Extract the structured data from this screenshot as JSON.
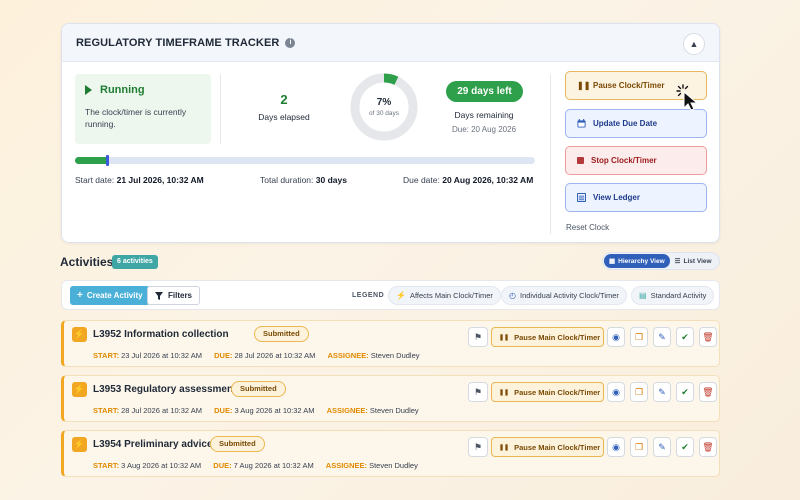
{
  "tracker": {
    "title": "REGULATORY TIMEFRAME TRACKER",
    "status": {
      "title": "Running",
      "description": "The clock/timer is currently running."
    },
    "elapsed": {
      "value": "2",
      "label": "Days elapsed"
    },
    "progress_ring": {
      "percent_label": "7%",
      "sub_label": "of 30 days",
      "fraction": 0.07
    },
    "remaining": {
      "badge": "29 days left",
      "label": "Days remaining",
      "due": "Due: 20 Aug 2026"
    },
    "timeline": {
      "fraction": 0.07,
      "start_label": "Start date:",
      "start_value": "21 Jul 2026, 10:32 AM",
      "duration_label": "Total duration:",
      "duration_value": "30 days",
      "due_label": "Due date:",
      "due_value": "20 Aug 2026, 10:32 AM"
    },
    "actions": {
      "pause": "Pause Clock/Timer",
      "update": "Update Due Date",
      "stop": "Stop Clock/Timer",
      "ledger": "View Ledger",
      "reset": "Reset Clock"
    }
  },
  "activities": {
    "title": "Activities",
    "count": "6 activities",
    "views": {
      "hierarchy": "Hierarchy View",
      "list": "List View"
    },
    "toolbar": {
      "create": "Create Activity",
      "filters": "Filters"
    },
    "legend": {
      "label": "LEGEND",
      "items": [
        "Affects Main Clock/Timer",
        "Individual Activity Clock/Timer",
        "Standard Activity"
      ]
    },
    "meta_labels": {
      "start": "START:",
      "due": "DUE:",
      "assignee": "ASSIGNEE:"
    },
    "pause_main_label": "Pause Main Clock/Timer",
    "items": [
      {
        "id": "L3952",
        "name": "L3952 Information collection",
        "status": "Submitted",
        "start": "23 Jul 2026 at 10:32 AM",
        "due": "28 Jul 2026 at 10:32 AM",
        "assignee": "Steven Dudley"
      },
      {
        "id": "L3953",
        "name": "L3953 Regulatory assessment",
        "status": "Submitted",
        "start": "28 Jul 2026 at 10:32 AM",
        "due": "3 Aug 2026 at 10:32 AM",
        "assignee": "Steven Dudley"
      },
      {
        "id": "L3954",
        "name": "L3954 Preliminary advice",
        "status": "Submitted",
        "start": "3 Aug 2026 at 10:32 AM",
        "due": "7 Aug 2026 at 10:32 AM",
        "assignee": "Steven Dudley"
      }
    ]
  },
  "colors": {
    "running_green": "#2e9f4a",
    "accent_blue": "#2f5fb8",
    "activity_orange": "#f2a722",
    "stop_red": "#c0392b"
  }
}
